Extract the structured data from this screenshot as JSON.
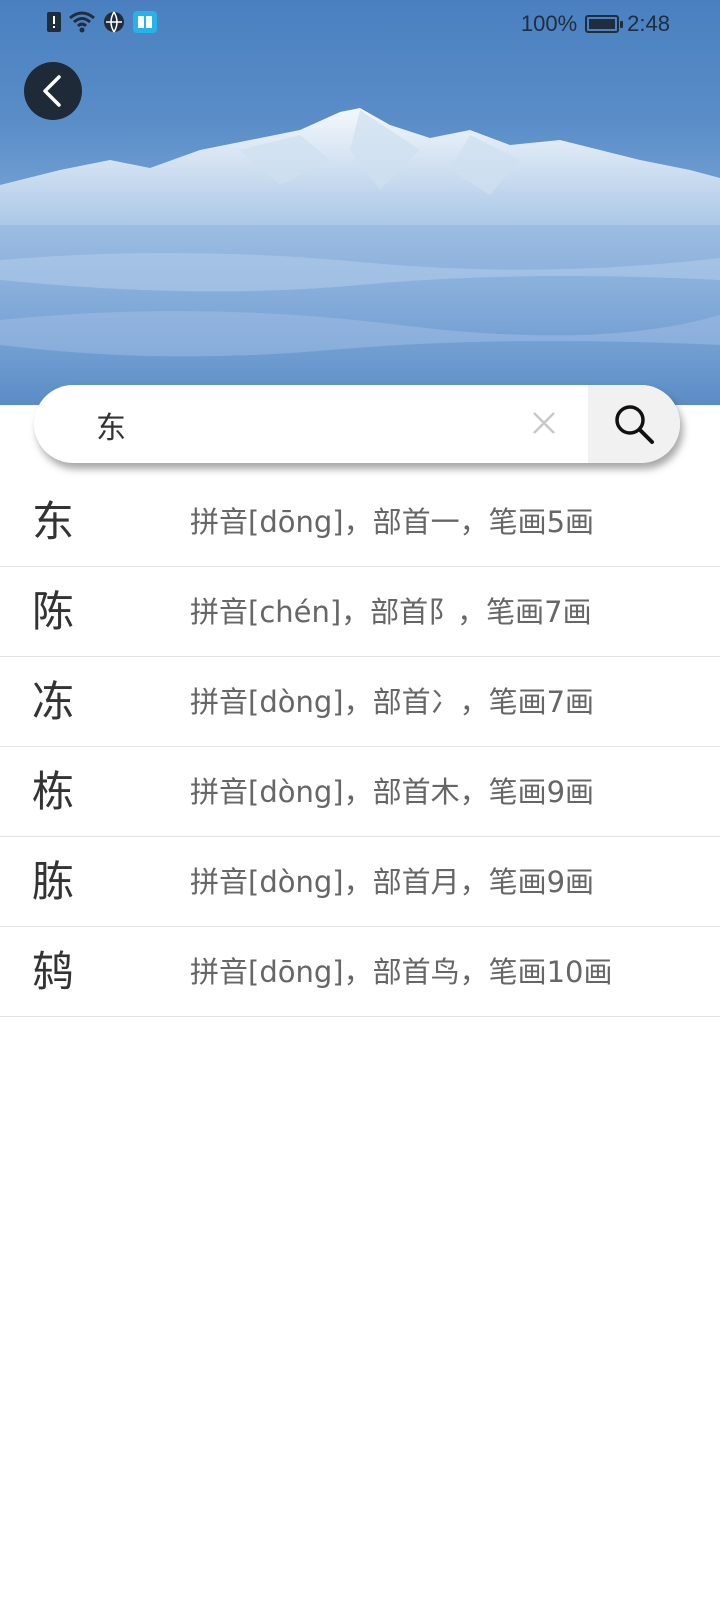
{
  "status_bar": {
    "battery": "100%",
    "time": "2:48",
    "icons": [
      "alert-icon",
      "wifi-icon",
      "globe-icon",
      "book-app-icon"
    ]
  },
  "header": {
    "back_icon": "chevron-left-icon",
    "hero_image": "snow-mountain"
  },
  "search": {
    "value": "东",
    "clear_icon": "close-icon",
    "search_icon": "search-icon"
  },
  "results": [
    {
      "char": "东",
      "desc": "拼音[dōng]，部首一，笔画5画"
    },
    {
      "char": "陈",
      "desc": "拼音[chén]，部首阝，笔画7画"
    },
    {
      "char": "冻",
      "desc": "拼音[dòng]，部首冫，笔画7画"
    },
    {
      "char": "栋",
      "desc": "拼音[dòng]，部首木，笔画9画"
    },
    {
      "char": "胨",
      "desc": "拼音[dòng]，部首月，笔画9画"
    },
    {
      "char": "鸫",
      "desc": "拼音[dōng]，部首鸟，笔画10画"
    }
  ],
  "colors": {
    "hero": "#5a8dc8",
    "back_button": "#1f2a38"
  }
}
